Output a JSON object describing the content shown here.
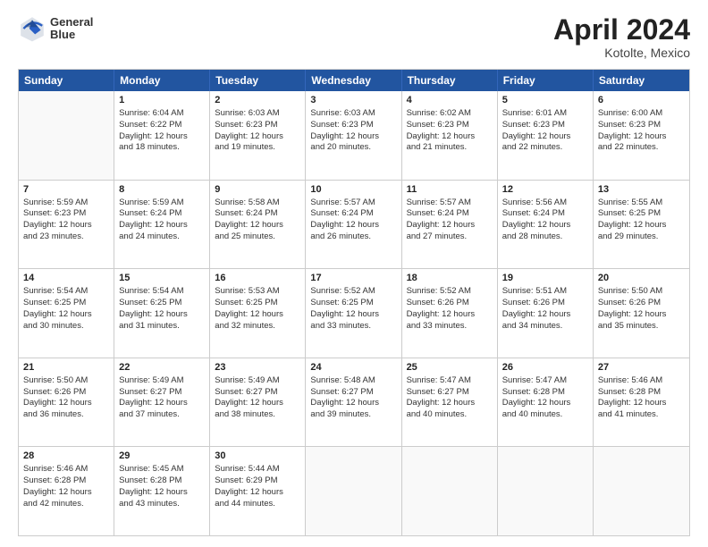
{
  "logo": {
    "line1": "General",
    "line2": "Blue"
  },
  "title": "April 2024",
  "location": "Kotolte, Mexico",
  "days": [
    "Sunday",
    "Monday",
    "Tuesday",
    "Wednesday",
    "Thursday",
    "Friday",
    "Saturday"
  ],
  "weeks": [
    [
      {
        "day": "",
        "info": ""
      },
      {
        "day": "1",
        "info": "Sunrise: 6:04 AM\nSunset: 6:22 PM\nDaylight: 12 hours\nand 18 minutes."
      },
      {
        "day": "2",
        "info": "Sunrise: 6:03 AM\nSunset: 6:23 PM\nDaylight: 12 hours\nand 19 minutes."
      },
      {
        "day": "3",
        "info": "Sunrise: 6:03 AM\nSunset: 6:23 PM\nDaylight: 12 hours\nand 20 minutes."
      },
      {
        "day": "4",
        "info": "Sunrise: 6:02 AM\nSunset: 6:23 PM\nDaylight: 12 hours\nand 21 minutes."
      },
      {
        "day": "5",
        "info": "Sunrise: 6:01 AM\nSunset: 6:23 PM\nDaylight: 12 hours\nand 22 minutes."
      },
      {
        "day": "6",
        "info": "Sunrise: 6:00 AM\nSunset: 6:23 PM\nDaylight: 12 hours\nand 22 minutes."
      }
    ],
    [
      {
        "day": "7",
        "info": "Sunrise: 5:59 AM\nSunset: 6:23 PM\nDaylight: 12 hours\nand 23 minutes."
      },
      {
        "day": "8",
        "info": "Sunrise: 5:59 AM\nSunset: 6:24 PM\nDaylight: 12 hours\nand 24 minutes."
      },
      {
        "day": "9",
        "info": "Sunrise: 5:58 AM\nSunset: 6:24 PM\nDaylight: 12 hours\nand 25 minutes."
      },
      {
        "day": "10",
        "info": "Sunrise: 5:57 AM\nSunset: 6:24 PM\nDaylight: 12 hours\nand 26 minutes."
      },
      {
        "day": "11",
        "info": "Sunrise: 5:57 AM\nSunset: 6:24 PM\nDaylight: 12 hours\nand 27 minutes."
      },
      {
        "day": "12",
        "info": "Sunrise: 5:56 AM\nSunset: 6:24 PM\nDaylight: 12 hours\nand 28 minutes."
      },
      {
        "day": "13",
        "info": "Sunrise: 5:55 AM\nSunset: 6:25 PM\nDaylight: 12 hours\nand 29 minutes."
      }
    ],
    [
      {
        "day": "14",
        "info": "Sunrise: 5:54 AM\nSunset: 6:25 PM\nDaylight: 12 hours\nand 30 minutes."
      },
      {
        "day": "15",
        "info": "Sunrise: 5:54 AM\nSunset: 6:25 PM\nDaylight: 12 hours\nand 31 minutes."
      },
      {
        "day": "16",
        "info": "Sunrise: 5:53 AM\nSunset: 6:25 PM\nDaylight: 12 hours\nand 32 minutes."
      },
      {
        "day": "17",
        "info": "Sunrise: 5:52 AM\nSunset: 6:25 PM\nDaylight: 12 hours\nand 33 minutes."
      },
      {
        "day": "18",
        "info": "Sunrise: 5:52 AM\nSunset: 6:26 PM\nDaylight: 12 hours\nand 33 minutes."
      },
      {
        "day": "19",
        "info": "Sunrise: 5:51 AM\nSunset: 6:26 PM\nDaylight: 12 hours\nand 34 minutes."
      },
      {
        "day": "20",
        "info": "Sunrise: 5:50 AM\nSunset: 6:26 PM\nDaylight: 12 hours\nand 35 minutes."
      }
    ],
    [
      {
        "day": "21",
        "info": "Sunrise: 5:50 AM\nSunset: 6:26 PM\nDaylight: 12 hours\nand 36 minutes."
      },
      {
        "day": "22",
        "info": "Sunrise: 5:49 AM\nSunset: 6:27 PM\nDaylight: 12 hours\nand 37 minutes."
      },
      {
        "day": "23",
        "info": "Sunrise: 5:49 AM\nSunset: 6:27 PM\nDaylight: 12 hours\nand 38 minutes."
      },
      {
        "day": "24",
        "info": "Sunrise: 5:48 AM\nSunset: 6:27 PM\nDaylight: 12 hours\nand 39 minutes."
      },
      {
        "day": "25",
        "info": "Sunrise: 5:47 AM\nSunset: 6:27 PM\nDaylight: 12 hours\nand 40 minutes."
      },
      {
        "day": "26",
        "info": "Sunrise: 5:47 AM\nSunset: 6:28 PM\nDaylight: 12 hours\nand 40 minutes."
      },
      {
        "day": "27",
        "info": "Sunrise: 5:46 AM\nSunset: 6:28 PM\nDaylight: 12 hours\nand 41 minutes."
      }
    ],
    [
      {
        "day": "28",
        "info": "Sunrise: 5:46 AM\nSunset: 6:28 PM\nDaylight: 12 hours\nand 42 minutes."
      },
      {
        "day": "29",
        "info": "Sunrise: 5:45 AM\nSunset: 6:28 PM\nDaylight: 12 hours\nand 43 minutes."
      },
      {
        "day": "30",
        "info": "Sunrise: 5:44 AM\nSunset: 6:29 PM\nDaylight: 12 hours\nand 44 minutes."
      },
      {
        "day": "",
        "info": ""
      },
      {
        "day": "",
        "info": ""
      },
      {
        "day": "",
        "info": ""
      },
      {
        "day": "",
        "info": ""
      }
    ]
  ]
}
